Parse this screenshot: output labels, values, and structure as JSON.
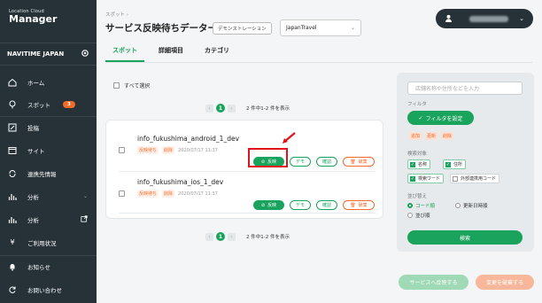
{
  "sidebar": {
    "logo_small": "Location Cloud",
    "logo_big": "Manager",
    "org_name": "NAVITIME JAPAN",
    "items": [
      {
        "label": "ホーム"
      },
      {
        "label": "スポット",
        "badge": "3"
      },
      {
        "label": "投稿"
      },
      {
        "label": "サイト"
      },
      {
        "label": "連携先情報"
      },
      {
        "label": "分析"
      },
      {
        "label": "分析"
      },
      {
        "label": "ご利用状況"
      },
      {
        "label": "お知らせ"
      },
      {
        "label": "お問い合わせ"
      }
    ]
  },
  "header": {
    "breadcrumb": "スポット ›",
    "title": "サービス反映待ちデーター覧",
    "demo_label": "デモンストレーション",
    "project": "JapanTravel"
  },
  "tabs": [
    {
      "label": "スポット"
    },
    {
      "label": "詳細項目"
    },
    {
      "label": "カテゴリ"
    }
  ],
  "select_all": "すべて選択",
  "pager": {
    "prev": "‹",
    "next": "›",
    "page": "1",
    "info": "2 件中1-2 件を表示"
  },
  "rows": [
    {
      "name": "info_fukushima_android_1_dev",
      "tag1": "反映待ち",
      "tag2": "削除",
      "date": "2020/07/17 11:37"
    },
    {
      "name": "info_fukushima_ios_1_dev",
      "tag1": "反映待ち",
      "tag2": "削除",
      "date": "2020/07/17 11:37"
    }
  ],
  "row_actions": {
    "reflect": "反映",
    "demo": "デモ",
    "confirm": "確認",
    "discard": "破棄"
  },
  "filter": {
    "search_placeholder": "店舗名称や住所などを入力",
    "filter_label": "フィルタ",
    "filter_button": "フィルタを設定",
    "status_tags": [
      "追加",
      "更新",
      "削除"
    ],
    "target_label": "検索対象",
    "targets": [
      "名称",
      "住所",
      "検索ワード",
      "外部連携用コード"
    ],
    "sort_label": "並び替え",
    "sort_options": [
      "コード順",
      "更新日時順",
      "並び順"
    ],
    "search_button": "検索"
  },
  "footer": {
    "apply": "サービスへ反映する",
    "discard_all": "変更を破棄する"
  },
  "colors": {
    "accent": "#1aa35c",
    "sidebar": "#273238",
    "warning": "#f26a2a",
    "highlight": "#e0121b"
  }
}
